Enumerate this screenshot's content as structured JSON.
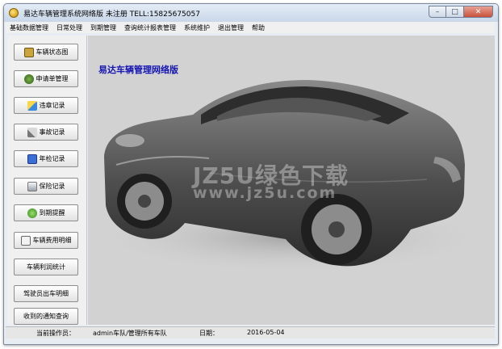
{
  "window": {
    "title": "易达车辆管理系统网络版 未注册 TELL:15825675057"
  },
  "window_controls": {
    "minimize": "–",
    "maximize": "□",
    "close": "✕"
  },
  "menu": [
    "基础数据管理",
    "日常处理",
    "到期管理",
    "查询统计报表管理",
    "系统维护",
    "退出管理",
    "帮助"
  ],
  "sidebar": {
    "items": [
      {
        "label": "车辆状态图",
        "icon": "car-status-icon"
      },
      {
        "label": "申请单管理",
        "icon": "application-icon"
      },
      {
        "label": "违章记录",
        "icon": "violation-icon"
      },
      {
        "label": "事故记录",
        "icon": "accident-icon"
      },
      {
        "label": "年检记录",
        "icon": "inspection-icon"
      },
      {
        "label": "保险记录",
        "icon": "insurance-icon"
      },
      {
        "label": "到期提醒",
        "icon": "reminder-icon"
      },
      {
        "label": "车辆费用明细",
        "icon": "fee-icon"
      },
      {
        "label": "车辆利润统计",
        "icon": ""
      },
      {
        "label": "驾驶员出车明细",
        "icon": ""
      },
      {
        "label": "收到的通知查询",
        "icon": ""
      }
    ]
  },
  "main": {
    "title": "易达车辆管理网络版",
    "watermark_top": "JZ5U绿色下载",
    "watermark_bottom": "www.jz5u.com"
  },
  "status": {
    "operator_label": "当前操作员：",
    "operator_value": "admin车队/管理所有车队",
    "date_label": "日期：",
    "date_value": "2016-05-04"
  }
}
